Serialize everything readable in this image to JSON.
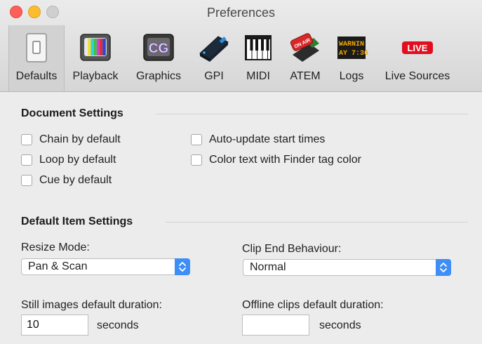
{
  "window": {
    "title": "Preferences"
  },
  "toolbar": {
    "tabs": [
      {
        "label": "Defaults",
        "icon": "switch-icon"
      },
      {
        "label": "Playback",
        "icon": "tv-icon"
      },
      {
        "label": "Graphics",
        "icon": "cg-icon"
      },
      {
        "label": "GPI",
        "icon": "gpi-box-icon"
      },
      {
        "label": "MIDI",
        "icon": "piano-keys-icon"
      },
      {
        "label": "ATEM",
        "icon": "on-air-switcher-icon"
      },
      {
        "label": "Logs",
        "icon": "led-display-icon"
      },
      {
        "label": "Live Sources",
        "icon": "live-badge-icon"
      }
    ],
    "selected": "Defaults",
    "graphics_icon_text": "CG",
    "logs_icon_text_1": "WARNIN",
    "logs_icon_text_2": "AY 7:36",
    "atem_icon_text": "ON AIR",
    "live_icon_text": "LIVE"
  },
  "document_settings": {
    "title": "Document Settings",
    "checkboxes": [
      {
        "label": "Chain by default",
        "checked": false
      },
      {
        "label": "Loop by default",
        "checked": false
      },
      {
        "label": "Cue by default",
        "checked": false
      },
      {
        "label": "Auto-update start times",
        "checked": false
      },
      {
        "label": "Color text with Finder tag color",
        "checked": false
      }
    ]
  },
  "default_item_settings": {
    "title": "Default Item Settings",
    "resize_mode": {
      "label": "Resize Mode:",
      "value": "Pan & Scan"
    },
    "clip_end": {
      "label": "Clip End Behaviour:",
      "value": "Normal"
    },
    "still_duration": {
      "label": "Still images default duration:",
      "value": "10",
      "units": "seconds"
    },
    "offline_duration": {
      "label": "Offline clips default duration:",
      "value": "",
      "units": "seconds"
    }
  },
  "colors": {
    "accent": "#3d8ef7",
    "close": "#fc5f57",
    "minimize": "#fdbc2e"
  }
}
